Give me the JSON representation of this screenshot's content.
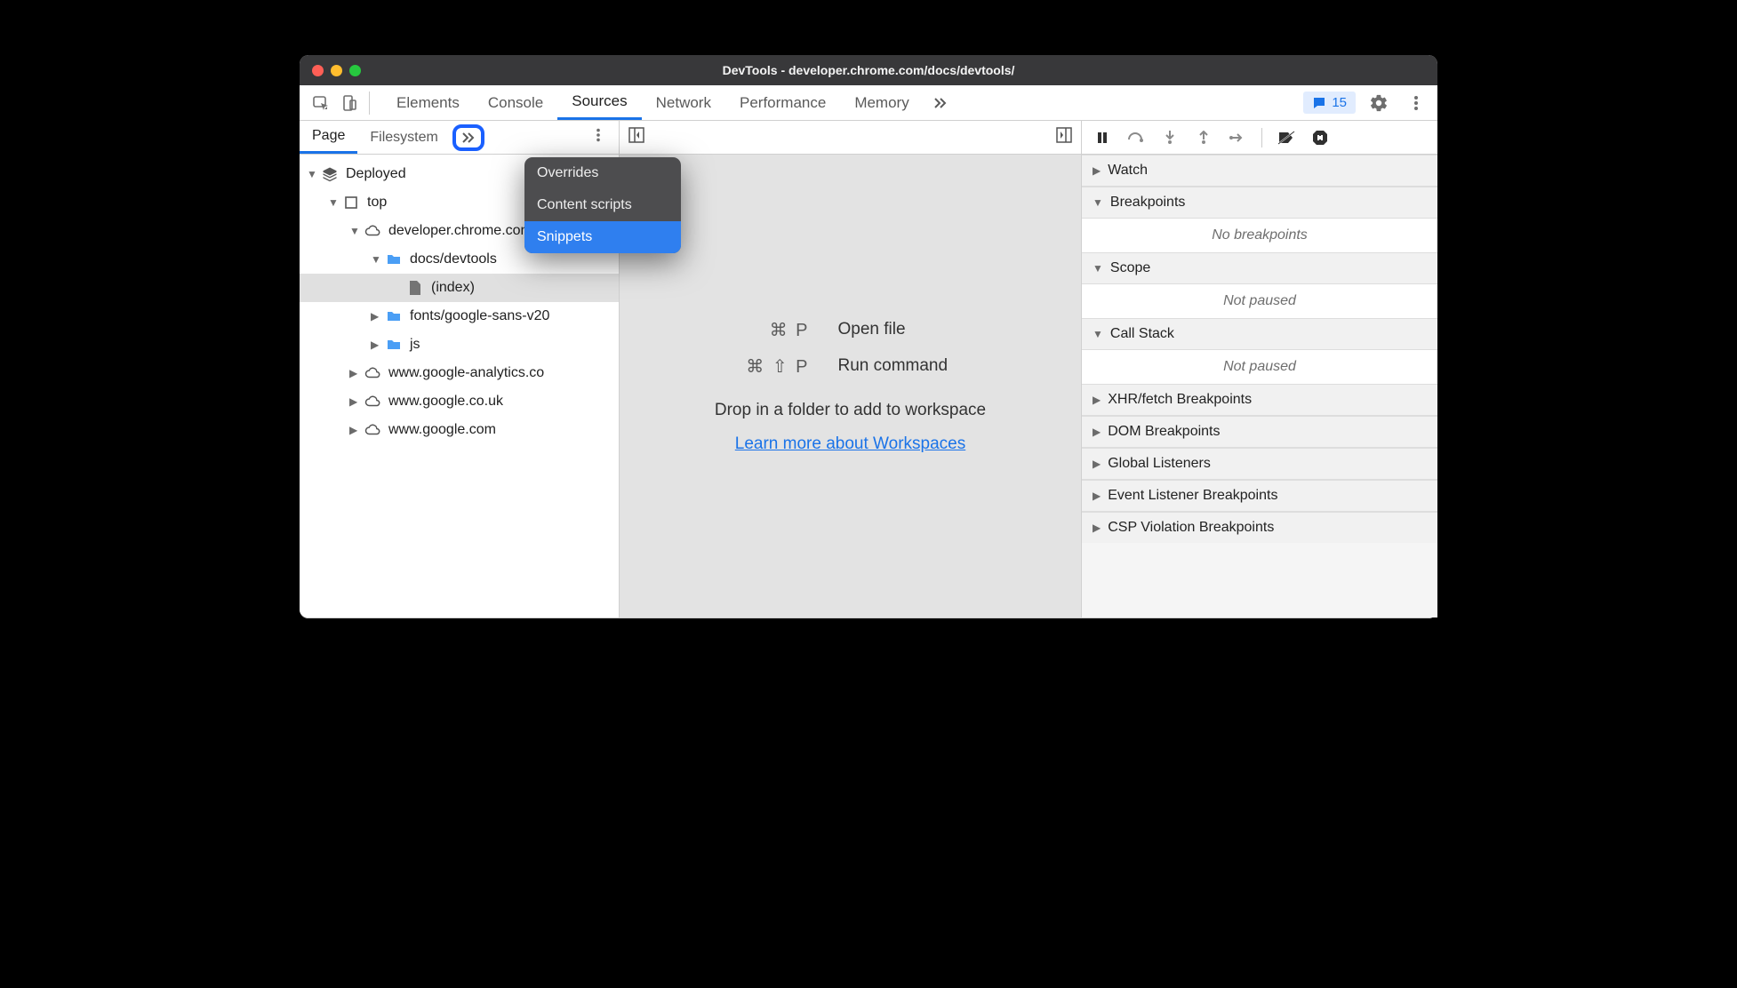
{
  "window": {
    "title": "DevTools - developer.chrome.com/docs/devtools/"
  },
  "toolbar": {
    "tabs": [
      "Elements",
      "Console",
      "Sources",
      "Network",
      "Performance",
      "Memory"
    ],
    "active_tab": "Sources",
    "issues_count": "15"
  },
  "nav": {
    "subtabs": [
      "Page",
      "Filesystem"
    ],
    "active_subtab": "Page",
    "overflow_menu": {
      "items": [
        "Overrides",
        "Content scripts",
        "Snippets"
      ],
      "selected": "Snippets"
    },
    "tree": {
      "root": "Deployed",
      "items": [
        {
          "label": "top",
          "depth": 1,
          "icon": "frame",
          "expanded": true
        },
        {
          "label": "developer.chrome.com",
          "depth": 2,
          "icon": "cloud",
          "expanded": true
        },
        {
          "label": "docs/devtools",
          "depth": 3,
          "icon": "folder",
          "expanded": true
        },
        {
          "label": "(index)",
          "depth": 4,
          "icon": "file",
          "selected": true
        },
        {
          "label": "fonts/google-sans-v20",
          "depth": 3,
          "icon": "folder",
          "expanded": false
        },
        {
          "label": "js",
          "depth": 3,
          "icon": "folder",
          "expanded": false
        },
        {
          "label": "www.google-analytics.co",
          "depth": 2,
          "icon": "cloud",
          "expanded": false
        },
        {
          "label": "www.google.co.uk",
          "depth": 2,
          "icon": "cloud",
          "expanded": false
        },
        {
          "label": "www.google.com",
          "depth": 2,
          "icon": "cloud",
          "expanded": false
        }
      ]
    }
  },
  "editor": {
    "shortcuts": [
      {
        "keys": "⌘ P",
        "label": "Open file"
      },
      {
        "keys": "⌘ ⇧ P",
        "label": "Run command"
      }
    ],
    "drop_text": "Drop in a folder to add to workspace",
    "learn_link": "Learn more about Workspaces"
  },
  "debug": {
    "sections": [
      {
        "title": "Watch",
        "expanded": false
      },
      {
        "title": "Breakpoints",
        "expanded": true,
        "body": "No breakpoints"
      },
      {
        "title": "Scope",
        "expanded": true,
        "body": "Not paused"
      },
      {
        "title": "Call Stack",
        "expanded": true,
        "body": "Not paused"
      },
      {
        "title": "XHR/fetch Breakpoints",
        "expanded": false
      },
      {
        "title": "DOM Breakpoints",
        "expanded": false
      },
      {
        "title": "Global Listeners",
        "expanded": false
      },
      {
        "title": "Event Listener Breakpoints",
        "expanded": false
      },
      {
        "title": "CSP Violation Breakpoints",
        "expanded": false
      }
    ]
  }
}
